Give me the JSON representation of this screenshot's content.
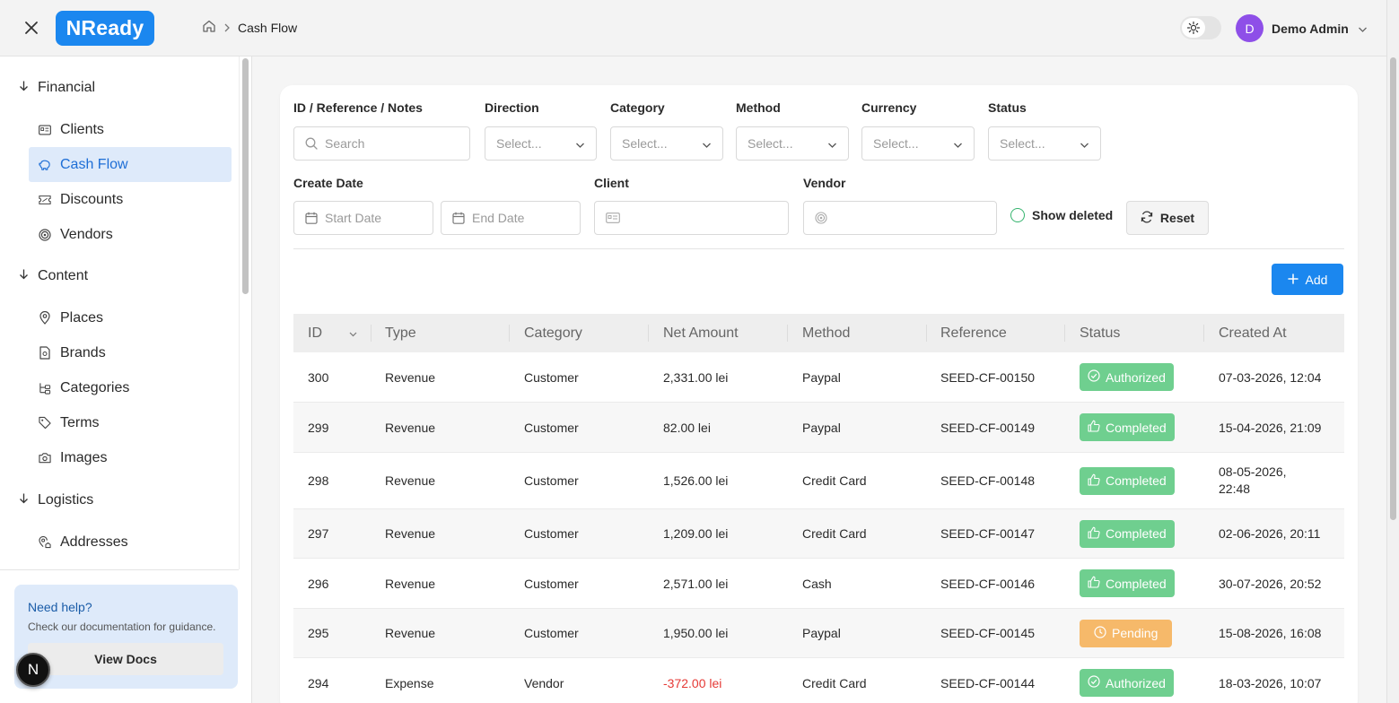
{
  "header": {
    "brand": "NReady",
    "breadcrumb": {
      "current": "Cash Flow"
    },
    "user": {
      "initial": "D",
      "name": "Demo Admin"
    }
  },
  "sidebar": {
    "groups": [
      {
        "label": "Financial",
        "items": [
          "Clients",
          "Cash Flow",
          "Discounts",
          "Vendors"
        ]
      },
      {
        "label": "Content",
        "items": [
          "Places",
          "Brands",
          "Categories",
          "Terms",
          "Images"
        ]
      },
      {
        "label": "Logistics",
        "items": [
          "Addresses"
        ]
      }
    ],
    "active_item": "Cash Flow",
    "help": {
      "title": "Need help?",
      "text": "Check our documentation for guidance.",
      "button": "View Docs"
    },
    "bubble_letter": "N"
  },
  "filters": {
    "search_label": "ID / Reference / Notes",
    "search_placeholder": "Search",
    "selects": [
      {
        "label": "Direction",
        "placeholder": "Select..."
      },
      {
        "label": "Category",
        "placeholder": "Select..."
      },
      {
        "label": "Method",
        "placeholder": "Select..."
      },
      {
        "label": "Currency",
        "placeholder": "Select..."
      },
      {
        "label": "Status",
        "placeholder": "Select..."
      }
    ],
    "create_date_label": "Create Date",
    "start_date_placeholder": "Start Date",
    "end_date_placeholder": "End Date",
    "client_label": "Client",
    "vendor_label": "Vendor",
    "show_deleted_label": "Show deleted",
    "reset_label": "Reset"
  },
  "toolbar": {
    "add_label": "Add"
  },
  "table": {
    "columns": [
      "ID",
      "Type",
      "Category",
      "Net Amount",
      "Method",
      "Reference",
      "Status",
      "Created At"
    ],
    "rows": [
      {
        "id": "300",
        "type": "Revenue",
        "category": "Customer",
        "amount": "2,331.00 lei",
        "method": "Paypal",
        "reference": "SEED-CF-00150",
        "status": "Authorized",
        "created": "07-03-2026, 12:04"
      },
      {
        "id": "299",
        "type": "Revenue",
        "category": "Customer",
        "amount": "82.00 lei",
        "method": "Paypal",
        "reference": "SEED-CF-00149",
        "status": "Completed",
        "created": "15-04-2026, 21:09"
      },
      {
        "id": "298",
        "type": "Revenue",
        "category": "Customer",
        "amount": "1,526.00 lei",
        "method": "Credit Card",
        "reference": "SEED-CF-00148",
        "status": "Completed",
        "created": "08-05-2026, 22:48"
      },
      {
        "id": "297",
        "type": "Revenue",
        "category": "Customer",
        "amount": "1,209.00 lei",
        "method": "Credit Card",
        "reference": "SEED-CF-00147",
        "status": "Completed",
        "created": "02-06-2026, 20:11"
      },
      {
        "id": "296",
        "type": "Revenue",
        "category": "Customer",
        "amount": "2,571.00 lei",
        "method": "Cash",
        "reference": "SEED-CF-00146",
        "status": "Completed",
        "created": "30-07-2026, 20:52"
      },
      {
        "id": "295",
        "type": "Revenue",
        "category": "Customer",
        "amount": "1,950.00 lei",
        "method": "Paypal",
        "reference": "SEED-CF-00145",
        "status": "Pending",
        "created": "15-08-2026, 16:08"
      },
      {
        "id": "294",
        "type": "Expense",
        "category": "Vendor",
        "amount": "-372.00 lei",
        "method": "Credit Card",
        "reference": "SEED-CF-00144",
        "status": "Authorized",
        "created": "18-03-2026, 10:07"
      }
    ]
  },
  "colors": {
    "accent": "#1b87ef",
    "status_green": "#6fcf8f",
    "status_orange": "#f6b96a",
    "negative": "#e53935"
  }
}
